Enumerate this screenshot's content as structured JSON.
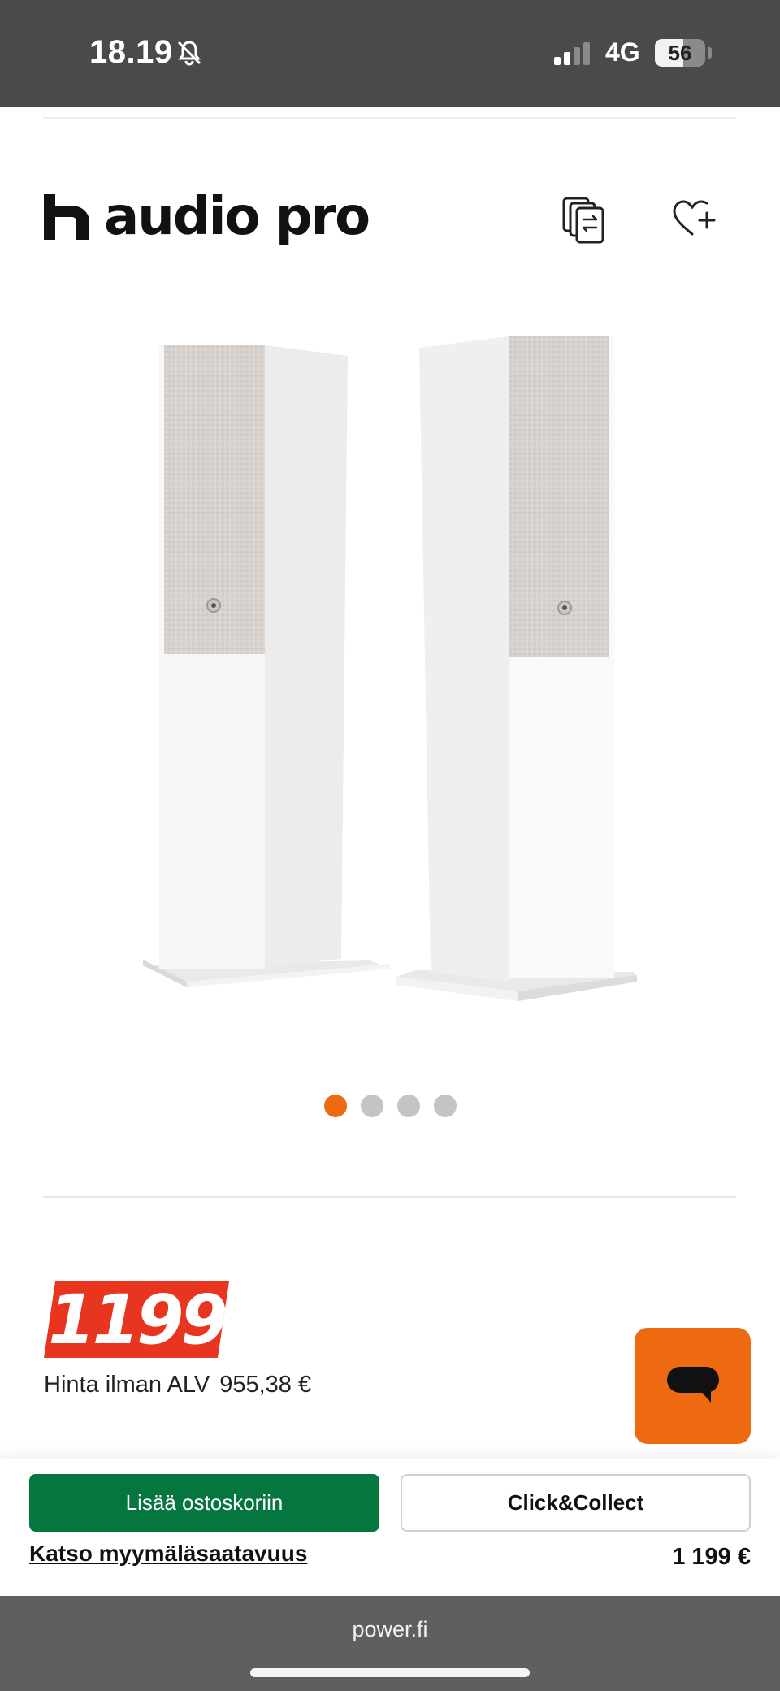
{
  "status_bar": {
    "time": "18.19",
    "network": "4G",
    "battery_level": "56",
    "battery_fraction": 0.56
  },
  "brand": {
    "name": "audio pro"
  },
  "icons": {
    "compare": "compare-icon",
    "wishlist": "heart-plus-icon",
    "chat": "chat-icon",
    "bell": "bell-muted-icon"
  },
  "carousel": {
    "count": 4,
    "active_index": 0
  },
  "price": {
    "value": "1199",
    "excl_vat_label": "Hinta ilman ALV",
    "excl_vat_value": "955,38 €"
  },
  "actions": {
    "add_to_cart": "Lisää ostoskoriin",
    "click_collect": "Click&Collect",
    "availability_link": "Katso myymäläsaatavuus",
    "total_price": "1 199 €"
  },
  "browser": {
    "url": "power.fi"
  },
  "colors": {
    "accent": "#ee6a10",
    "price_badge": "#e8351f",
    "primary_button": "#05773e"
  }
}
